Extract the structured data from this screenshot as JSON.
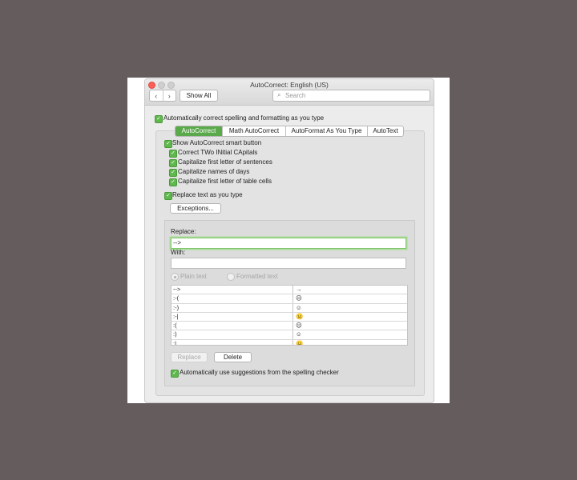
{
  "window": {
    "title": "AutoCorrect: English (US)"
  },
  "toolbar": {
    "back_glyph": "‹",
    "forward_glyph": "›",
    "show_all_label": "Show All",
    "search_placeholder": "Search",
    "search_icon": "magnifier-icon"
  },
  "auto_correct_main": {
    "label": "Automatically correct spelling and formatting as you type",
    "checked": true
  },
  "tabs": [
    {
      "label": "AutoCorrect",
      "active": true
    },
    {
      "label": "Math AutoCorrect",
      "active": false
    },
    {
      "label": "AutoFormat As You Type",
      "active": false
    },
    {
      "label": "AutoText",
      "active": false
    }
  ],
  "options": {
    "show_smart_button": "Show AutoCorrect smart button",
    "two_initial_caps": "Correct TWo INitial CApitals",
    "cap_first_sentence": "Capitalize first letter of sentences",
    "cap_days": "Capitalize names of days",
    "cap_table_cells": "Capitalize first letter of table cells",
    "replace_text": "Replace text as you type"
  },
  "exceptions_label": "Exceptions...",
  "replace": {
    "label": "Replace:",
    "value": "-->"
  },
  "with": {
    "label": "With:",
    "value": ""
  },
  "format": {
    "plain": "Plain text",
    "formatted": "Formatted text"
  },
  "table": {
    "rows": [
      {
        "replace": "-->",
        "with": "→"
      },
      {
        "replace": ":-(",
        "with": "☹"
      },
      {
        "replace": ":-)",
        "with": "☺"
      },
      {
        "replace": ":-|",
        "with": "😐"
      },
      {
        "replace": ":(",
        "with": "☹"
      },
      {
        "replace": ":)",
        "with": "☺"
      },
      {
        "replace": ":|",
        "with": "😐"
      }
    ]
  },
  "actions": {
    "replace_label": "Replace",
    "delete_label": "Delete"
  },
  "spelling_suggestions": "Automatically use suggestions from the spelling checker",
  "colors": {
    "accent": "#5aa94a",
    "background": "#655d5d"
  }
}
